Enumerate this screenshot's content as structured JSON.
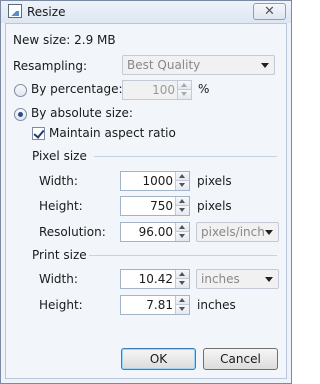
{
  "window": {
    "title": "Resize",
    "close_glyph": "✕"
  },
  "info": {
    "new_size": "New size: 2.9 MB"
  },
  "resampling": {
    "label": "Resampling:",
    "selected": "Best Quality"
  },
  "by_percentage": {
    "label": "By percentage:",
    "value": "100",
    "unit": "%"
  },
  "by_absolute": {
    "label": "By absolute size:"
  },
  "maintain_aspect": {
    "label": "Maintain aspect ratio"
  },
  "pixel_size": {
    "heading": "Pixel size",
    "width_label": "Width:",
    "width_value": "1000",
    "width_unit": "pixels",
    "height_label": "Height:",
    "height_value": "750",
    "height_unit": "pixels",
    "resolution_label": "Resolution:",
    "resolution_value": "96.00",
    "resolution_unit": "pixels/inch"
  },
  "print_size": {
    "heading": "Print size",
    "width_label": "Width:",
    "width_value": "10.42",
    "width_unit": "inches",
    "height_label": "Height:",
    "height_value": "7.81",
    "height_unit": "inches"
  },
  "buttons": {
    "ok": "OK",
    "cancel": "Cancel"
  }
}
